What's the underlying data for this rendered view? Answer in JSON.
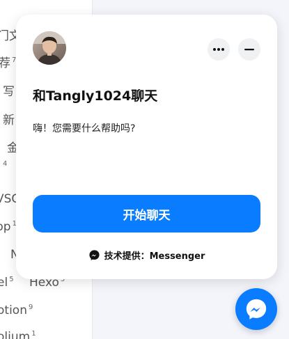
{
  "background": {
    "items": [
      {
        "text": "门文",
        "sup": ""
      },
      {
        "text": "荐",
        "sup": "7"
      },
      {
        "text": "写",
        "sup": ""
      },
      {
        "text": "新",
        "sup": ""
      },
      {
        "text": "金",
        "sup": ""
      },
      {
        "text": "",
        "sup": "4"
      },
      {
        "text": "VSC",
        "sup": ""
      },
      {
        "text": "pp",
        "sup": "1"
      },
      {
        "text": "N",
        "sup": ""
      },
      {
        "text": "el",
        "sup": "5"
      },
      {
        "text": "Hexo",
        "sup": "3"
      },
      {
        "text": "otion",
        "sup": "9"
      },
      {
        "text": "olium",
        "sup": "1"
      }
    ]
  },
  "chat": {
    "title": "和Tangly1024聊天",
    "greeting": "嗨！您需要什么帮助吗?",
    "start_button": "开始聊天",
    "powered_by": "技术提供：Messenger",
    "more_icon": "more-horizontal-icon",
    "minimize_icon": "minimize-icon",
    "messenger_icon": "messenger-icon",
    "accent": "#0a7cff"
  }
}
